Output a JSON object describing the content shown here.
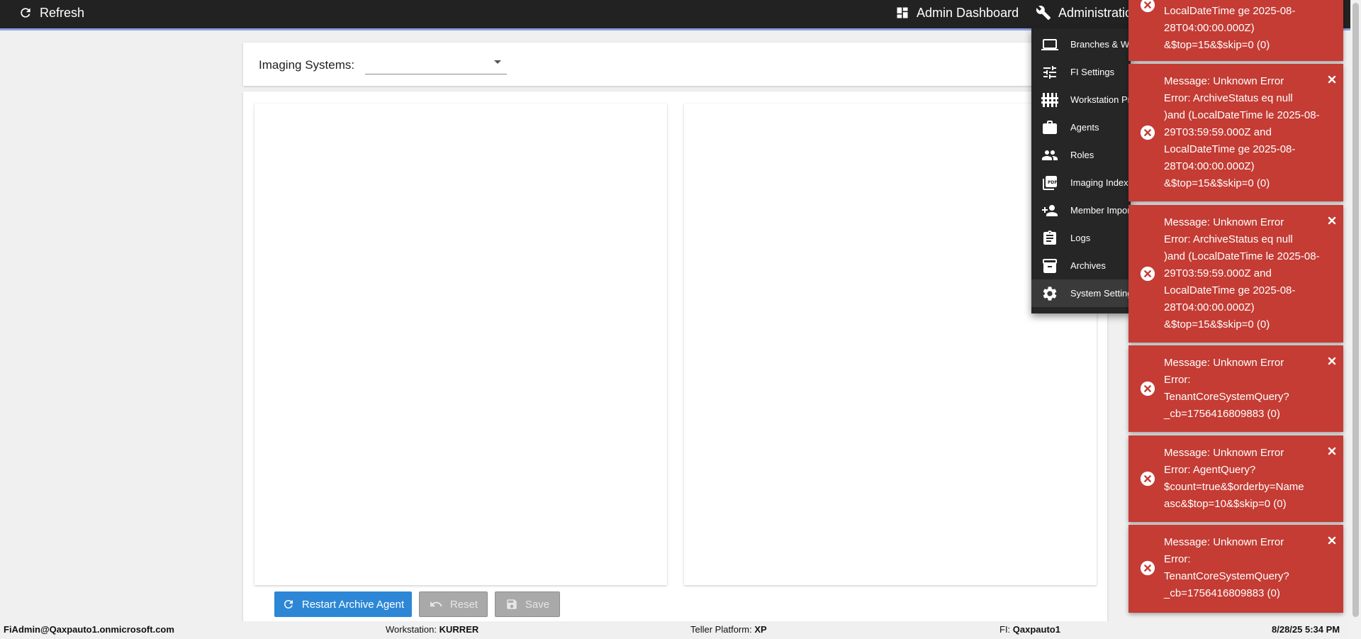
{
  "topbar": {
    "refresh_label": "Refresh",
    "admin_dashboard_label": "Admin Dashboard",
    "administration_label": "Administration"
  },
  "filter": {
    "imaging_systems_label": "Imaging Systems:",
    "imaging_systems_value": ""
  },
  "actions": {
    "restart_label": "Restart Archive Agent",
    "reset_label": "Reset",
    "save_label": "Save"
  },
  "admin_menu": {
    "items": [
      {
        "label": "Branches & W",
        "icon": "laptop-icon"
      },
      {
        "label": "FI Settings",
        "icon": "sliders-icon"
      },
      {
        "label": "Workstation Pr",
        "icon": "workstation-profiles-icon"
      },
      {
        "label": "Agents",
        "icon": "briefcase-icon"
      },
      {
        "label": "Roles",
        "icon": "people-icon"
      },
      {
        "label": "Imaging Index",
        "icon": "pdf-icon"
      },
      {
        "label": "Member Impor",
        "icon": "person-add-icon"
      },
      {
        "label": "Logs",
        "icon": "clipboard-icon"
      },
      {
        "label": "Archives",
        "icon": "archive-icon"
      },
      {
        "label": "System Setting",
        "icon": "gear-icon"
      }
    ]
  },
  "toasts": [
    {
      "lines": [
        "LocalDateTime ge 2025-08-",
        "28T04:00:00.000Z)",
        "&$top=15&$skip=0 (0)"
      ]
    },
    {
      "lines": [
        "Message: Unknown Error",
        "Error: ArchiveStatus eq null",
        ")and (LocalDateTime le 2025-08-",
        "29T03:59:59.000Z and",
        "LocalDateTime ge 2025-08-",
        "28T04:00:00.000Z)",
        "&$top=15&$skip=0 (0)"
      ]
    },
    {
      "lines": [
        "Message: Unknown Error",
        "Error: ArchiveStatus eq null",
        ")and (LocalDateTime le 2025-08-",
        "29T03:59:59.000Z and",
        "LocalDateTime ge 2025-08-",
        "28T04:00:00.000Z)",
        "&$top=15&$skip=0 (0)"
      ]
    },
    {
      "lines": [
        "Message: Unknown Error",
        "Error:",
        "TenantCoreSystemQuery?",
        "_cb=1756416809883 (0)"
      ]
    },
    {
      "lines": [
        "Message: Unknown Error",
        "Error: AgentQuery?",
        "$count=true&$orderby=Name",
        "asc&$top=10&$skip=0 (0)"
      ]
    },
    {
      "lines": [
        "Message: Unknown Error",
        "Error:",
        "TenantCoreSystemQuery?",
        "_cb=1756416809883 (0)"
      ]
    }
  ],
  "footer": {
    "user": "FiAdmin@Qaxpauto1.onmicrosoft.com",
    "workstation_label": "Workstation:",
    "workstation_value": "KURRER",
    "teller_label": "Teller Platform:",
    "teller_value": "XP",
    "fi_label": "FI:",
    "fi_value": "Qaxpauto1",
    "datetime": "8/28/25 5:34 PM"
  },
  "colors": {
    "topbar": "#222222",
    "primary_button": "#2d87d6",
    "toast_error": "#c43c34",
    "menu_bg": "#262626"
  }
}
